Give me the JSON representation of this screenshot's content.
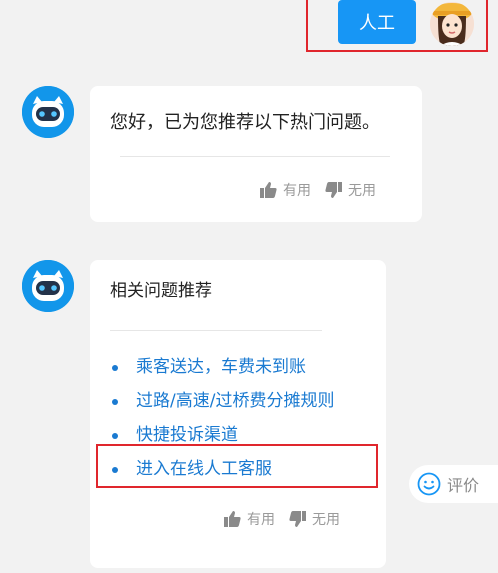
{
  "user": {
    "message": "人工"
  },
  "bot_messages": [
    {
      "text": "您好，已为您推荐以下热门问题。",
      "feedback": {
        "useful": "有用",
        "useless": "无用"
      }
    },
    {
      "title": "相关问题推荐",
      "questions": [
        "乘客送达，车费未到账",
        "过路/高速/过桥费分摊规则",
        "快捷投诉渠道",
        "进入在线人工客服"
      ],
      "feedback": {
        "useful": "有用",
        "useless": "无用"
      }
    }
  ],
  "evaluate": {
    "label": "评价"
  },
  "colors": {
    "accent_blue": "#1796f5",
    "link_blue": "#1a7ad1",
    "highlight_red": "#e0262d",
    "bot_avatar_blue": "#1296ea"
  },
  "icons": {
    "thumb_up": "thumb-up-icon",
    "thumb_down": "thumb-down-icon",
    "smile": "smile-icon",
    "bot": "robot-avatar-icon"
  }
}
